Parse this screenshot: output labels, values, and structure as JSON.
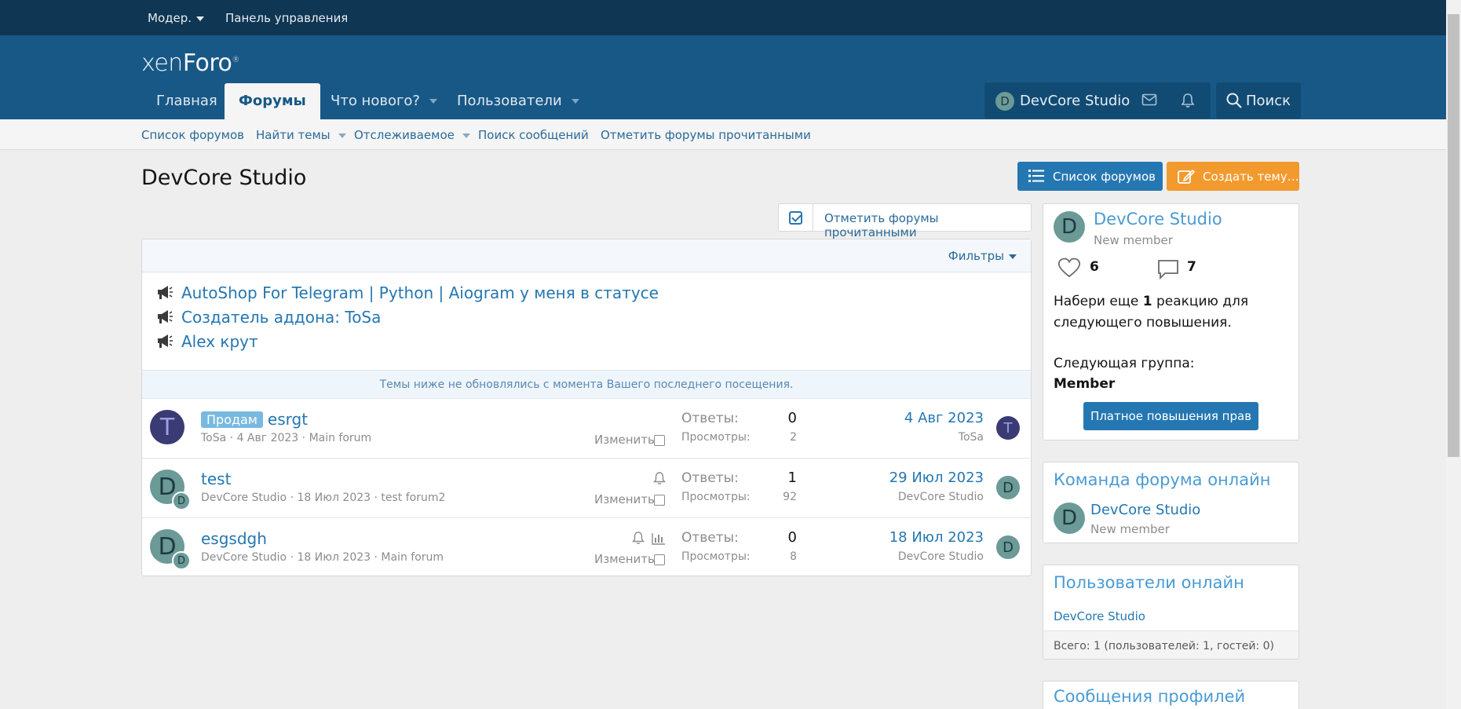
{
  "staffbar": {
    "moderator_label": "Модер.",
    "control_panel": "Панель управления"
  },
  "header": {
    "logo_light": "xen",
    "logo_bold": "Foro",
    "nav": [
      {
        "label": "Главная"
      },
      {
        "label": "Форумы"
      },
      {
        "label": "Что нового?"
      },
      {
        "label": "Пользователи"
      }
    ],
    "visitor": {
      "initial": "D",
      "name": "DevCore Studio"
    },
    "search_label": "Поиск"
  },
  "subnav": [
    "Список форумов",
    "Найти темы",
    "Отслеживаемое",
    "Поиск сообщений",
    "Отметить форумы прочитанными"
  ],
  "page": {
    "title": "DevCore Studio",
    "forum_list_button": "Список форумов",
    "create_thread_button": "Создать тему…",
    "mark_read_button": "Отметить форумы прочитанными",
    "filters_label": "Фильтры",
    "notice": "Темы ниже не обновлялись с момента Вашего последнего посещения."
  },
  "sticky": [
    "AutoShop For Telegram | Python | Aiogram у меня в статусе",
    "Создатель аддона: ToSa",
    "Alex крут"
  ],
  "threads": [
    {
      "avatar": "T",
      "prefix": "Продам",
      "title": "esrgt",
      "author": "ToSa",
      "date": "4 Авг 2023",
      "forum": "Main forum",
      "edit": "Изменить",
      "replies_label": "Ответы:",
      "replies": "0",
      "views_label": "Просмотры:",
      "views": "2",
      "last_date": "4 Авг 2023",
      "last_user": "ToSa",
      "last_avatar": "T"
    },
    {
      "avatar": "D",
      "mini": "D",
      "title": "test",
      "author": "DevCore Studio",
      "date": "18 Июл 2023",
      "forum": "test forum2",
      "edit": "Изменить",
      "replies_label": "Ответы:",
      "replies": "1",
      "views_label": "Просмотры:",
      "views": "92",
      "last_date": "29 Июл 2023",
      "last_user": "DevCore Studio",
      "last_avatar": "D"
    },
    {
      "avatar": "D",
      "mini": "D",
      "title": "esgsdgh",
      "author": "DevCore Studio",
      "date": "18 Июл 2023",
      "forum": "Main forum",
      "edit": "Изменить",
      "replies_label": "Ответы:",
      "replies": "0",
      "views_label": "Просмотры:",
      "views": "8",
      "last_date": "18 Июл 2023",
      "last_user": "DevCore Studio",
      "last_avatar": "D"
    }
  ],
  "sidebar": {
    "member": {
      "initial": "D",
      "name": "DevCore Studio",
      "title": "New member",
      "reactions": "6",
      "messages": "7",
      "progress_pre": "Набери еще ",
      "progress_count": "1",
      "progress_post": " реакцию для",
      "progress_line2": "следующего повышения.",
      "next_group_label": "Следующая группа:",
      "next_group": "Member",
      "upgrade_button": "Платное повышения прав"
    },
    "staff_online": {
      "heading": "Команда форума онлайн",
      "initial": "D",
      "name": "DevCore Studio",
      "title": "New member"
    },
    "users_online": {
      "heading": "Пользователи онлайн",
      "user": "DevCore Studio",
      "footer": "Всего: 1 (пользователей: 1, гостей: 0)"
    },
    "profile_posts": {
      "heading": "Сообщения профилей"
    }
  },
  "colors": {
    "staffbar": "#0f3652",
    "header": "#185886",
    "accent": "#2577b1",
    "orange": "#f29a2e"
  }
}
